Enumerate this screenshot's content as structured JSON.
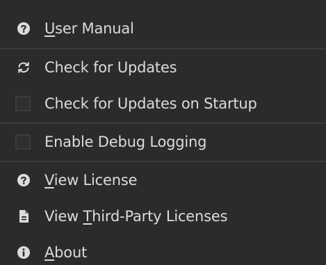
{
  "colors": {
    "menu_background": "#2b2b2b",
    "text": "#dcdcdc",
    "separator": "#3a3a3a",
    "checkbox_border": "#3c3c3c"
  },
  "menu": {
    "items": [
      {
        "pre": "",
        "mn": "U",
        "post": "ser Manual",
        "icon": "help-circle-icon"
      },
      {
        "pre": "Check for Updates",
        "mn": "",
        "post": "",
        "icon": "refresh-icon"
      },
      {
        "pre": "Check for Updates on Startup",
        "mn": "",
        "post": "",
        "checked": false
      },
      {
        "pre": "Enable Debug Logging",
        "mn": "",
        "post": "",
        "checked": false
      },
      {
        "pre": "",
        "mn": "V",
        "post": "iew License",
        "icon": "help-circle-icon"
      },
      {
        "pre": "View ",
        "mn": "T",
        "post": "hird-Party Licenses",
        "icon": "document-icon"
      },
      {
        "pre": "",
        "mn": "A",
        "post": "bout",
        "icon": "info-circle-icon"
      }
    ]
  }
}
